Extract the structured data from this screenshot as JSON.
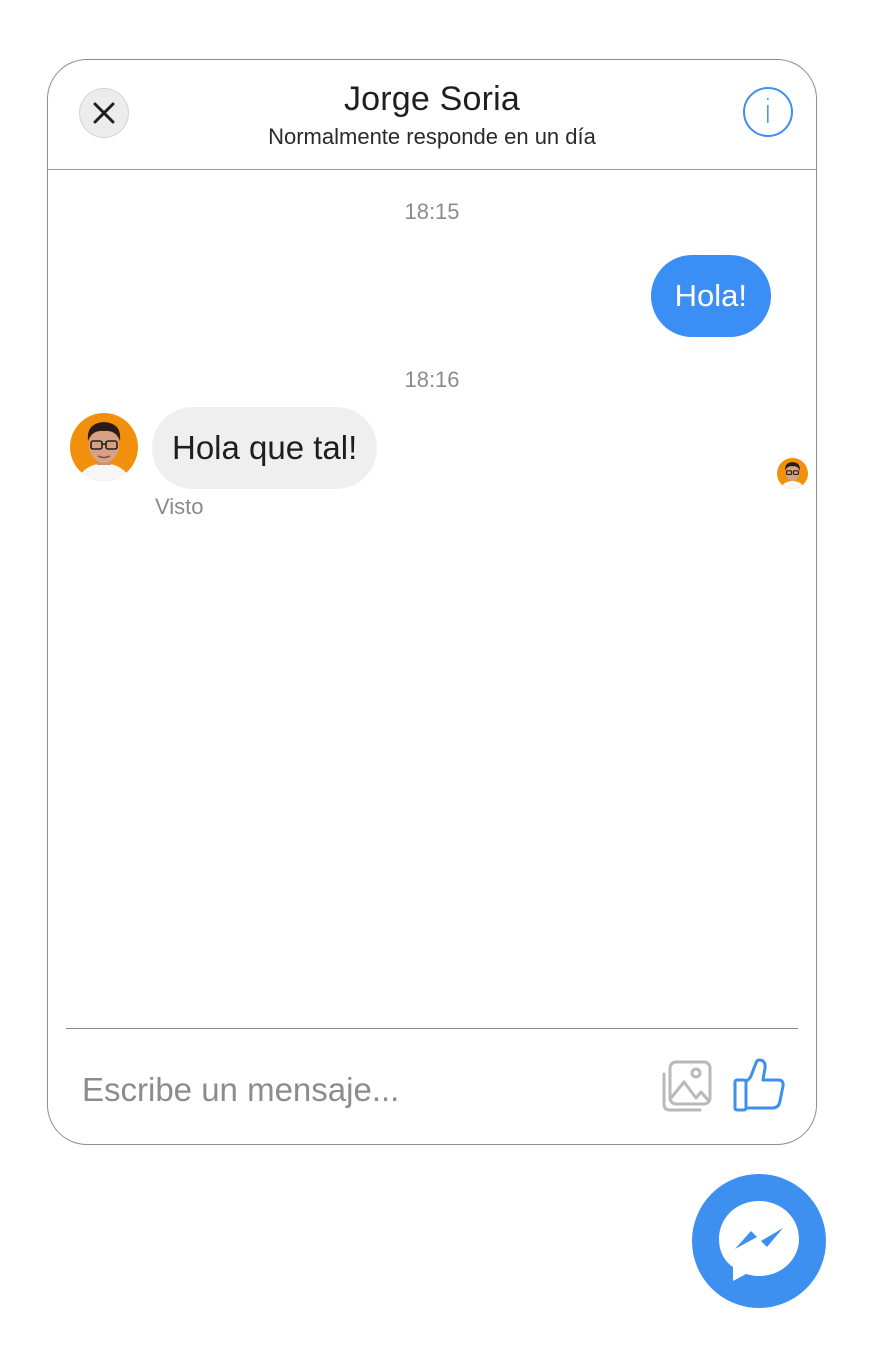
{
  "header": {
    "contact_name": "Jorge Soria",
    "status": "Normalmente responde en un día",
    "close_icon": "close-icon",
    "info_icon": "info-icon",
    "info_glyph": "i"
  },
  "messages": [
    {
      "time": "18:15",
      "direction": "outgoing",
      "text": "Hola!"
    },
    {
      "time": "18:16",
      "direction": "incoming",
      "text": "Hola que tal!",
      "status": "Visto"
    }
  ],
  "composer": {
    "placeholder": "Escribe un mensaje...",
    "image_icon": "image-icon",
    "like_icon": "thumbs-up-icon"
  },
  "fab": {
    "icon": "messenger-icon"
  },
  "colors": {
    "accent": "#3d8ff0",
    "outgoing_bubble": "#3b8ef3",
    "incoming_bubble": "#efefef",
    "avatar_bg": "#f0900c"
  }
}
